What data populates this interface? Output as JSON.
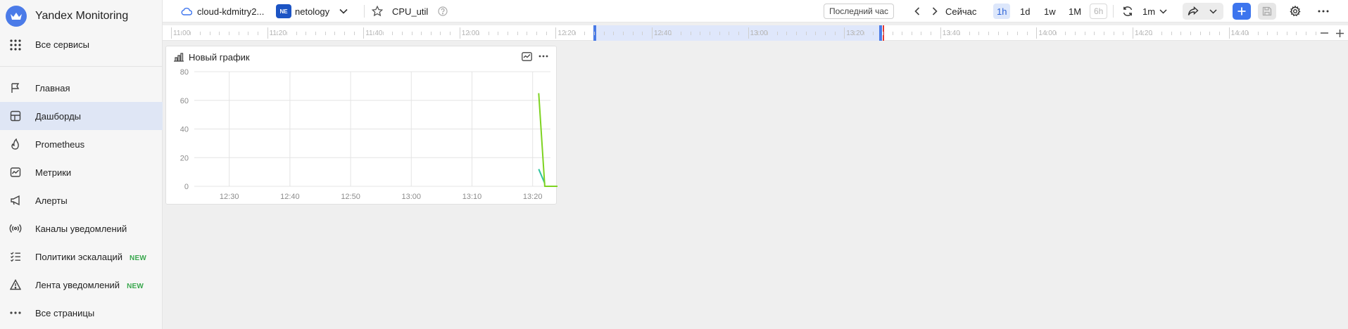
{
  "sidebar": {
    "brand": "Yandex Monitoring",
    "all_services": "Все сервисы",
    "items": [
      {
        "label": "Главная",
        "icon": "flag-icon",
        "active": false
      },
      {
        "label": "Дашборды",
        "icon": "dashboard-icon",
        "active": true
      },
      {
        "label": "Prometheus",
        "icon": "prometheus-flame-icon",
        "active": false
      },
      {
        "label": "Метрики",
        "icon": "metrics-chart-icon",
        "active": false
      },
      {
        "label": "Алерты",
        "icon": "megaphone-icon",
        "active": false
      },
      {
        "label": "Каналы уведомлений",
        "icon": "broadcast-icon",
        "active": false
      },
      {
        "label": "Политики эскалаций",
        "icon": "checklist-icon",
        "active": false,
        "badge": "NEW"
      },
      {
        "label": "Лента уведомлений",
        "icon": "alert-triangle-icon",
        "active": false,
        "badge": "NEW"
      },
      {
        "label": "Все страницы",
        "icon": "more-dots-icon",
        "active": false
      }
    ]
  },
  "topbar": {
    "cloud": "cloud-kdmitry2...",
    "folder_chip": "NE",
    "folder": "netology",
    "dashboard_name": "CPU_util",
    "range": "Последний час",
    "now": "Сейчас",
    "periods": [
      "1h",
      "1d",
      "1w",
      "1M"
    ],
    "period_active": "1h",
    "period_disabled": "6h",
    "refresh": "1m"
  },
  "timeline": {
    "labels": [
      "11:00",
      "11:20",
      "11:40",
      "12:00",
      "12:20",
      "12:40",
      "13:00",
      "13:20",
      "13:40",
      "14:00",
      "14:20",
      "14:40"
    ],
    "selection": {
      "start": "12:29",
      "end": "13:29"
    }
  },
  "panel": {
    "title": "Новый график"
  },
  "chart_data": {
    "type": "line",
    "title": "Новый график",
    "xlabel": "",
    "ylabel": "",
    "x_ticks": [
      "12:30",
      "12:40",
      "12:50",
      "13:00",
      "13:10",
      "13:20"
    ],
    "y_ticks": [
      0,
      20,
      40,
      60,
      80
    ],
    "ylim": [
      0,
      80
    ],
    "grid": true,
    "series": [
      {
        "color": "#7ed321",
        "x": [
          "13:21",
          "13:22",
          "13:23",
          "13:24",
          "13:25",
          "13:26",
          "13:27"
        ],
        "y": [
          65,
          0,
          0,
          0,
          0,
          0,
          0
        ]
      },
      {
        "color": "#2ec4a0",
        "x": [
          "13:21",
          "13:22"
        ],
        "y": [
          12,
          2
        ]
      }
    ]
  },
  "colors": {
    "accent": "#3d75ee",
    "active_nav": "#dfe6f5",
    "selection": "#dfe7fb",
    "now_marker": "#e53935"
  }
}
